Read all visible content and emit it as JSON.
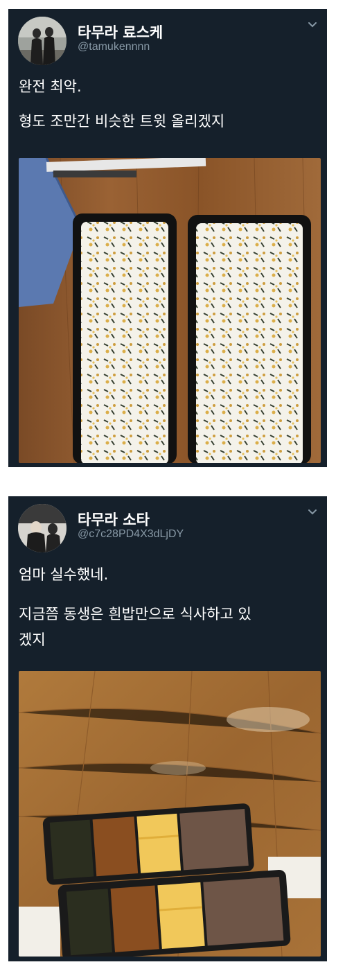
{
  "tweets": [
    {
      "display_name": "타무라 료스케",
      "handle": "@tamukennnn",
      "lines": [
        "완전 최악.",
        "형도 조만간 비슷한 트윗 올리겠지"
      ],
      "photo": "two-bento-boxes-filled-with-rice-and-furikake"
    },
    {
      "display_name": "타무라 소타",
      "handle": "@c7c28PD4X3dLjDY",
      "lines": [
        "엄마 실수했네.",
        "지금쯤 동생은 흰밥만으로 식사하고 있",
        "겠지"
      ],
      "photo": "two-bento-boxes-filled-with-side-dishes"
    }
  ],
  "icons": {
    "more": "chevron-down-icon"
  },
  "colors": {
    "tweet_bg": "#15202b",
    "name": "#ffffff",
    "handle": "#8899a6"
  }
}
